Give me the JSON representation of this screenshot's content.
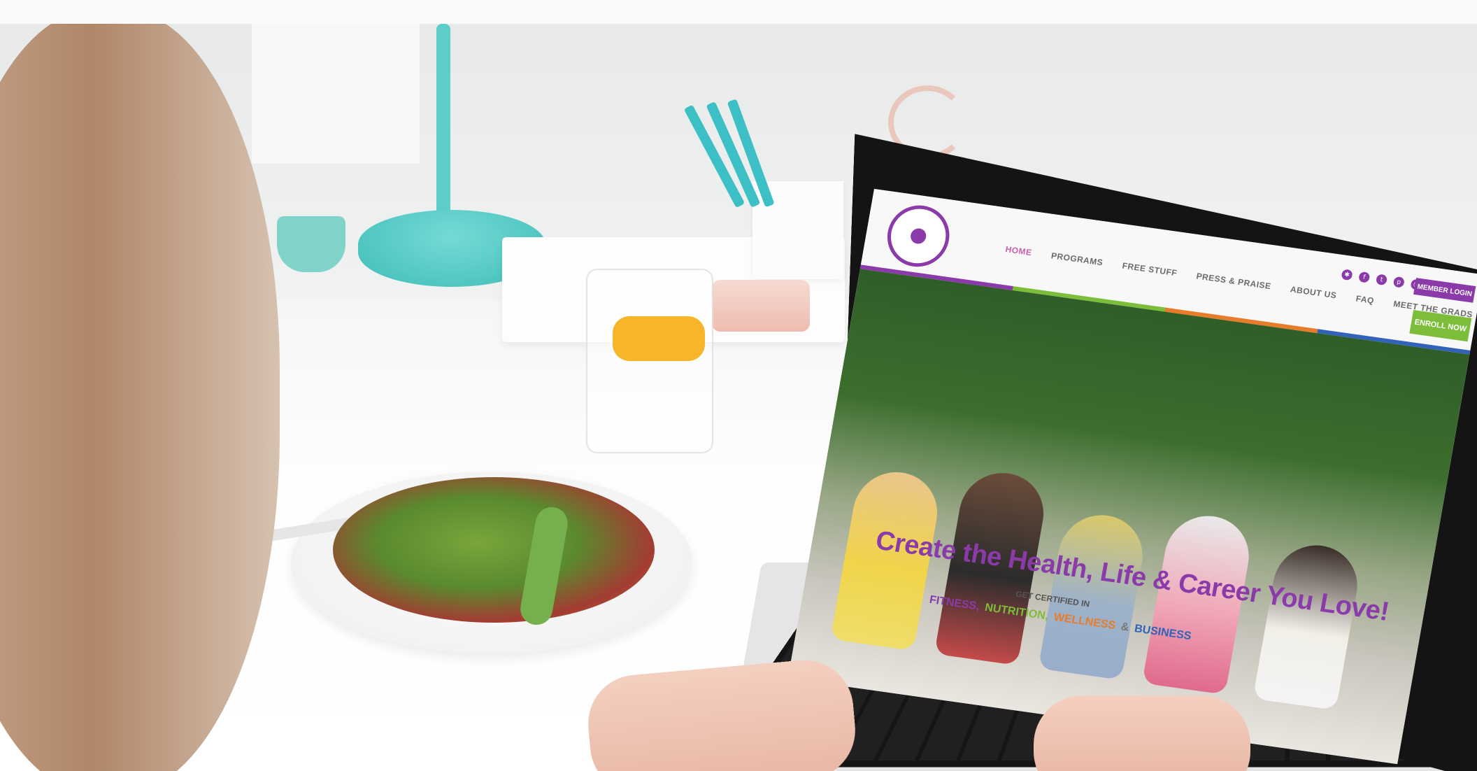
{
  "website": {
    "nav": {
      "items": [
        "HOME",
        "PROGRAMS",
        "FREE STUFF",
        "PRESS & PRAISE",
        "ABOUT US",
        "FAQ",
        "MEET THE GRADS"
      ]
    },
    "member_login": "MEMBER LOGIN",
    "enroll_now": "ENROLL NOW",
    "hero": {
      "title": "Create the Health, Life & Career You Love!",
      "subtitle": "GET CERTIFIED IN",
      "tags": [
        "FITNESS,",
        "NUTRITION,",
        "WELLNESS",
        "&",
        "BUSINESS"
      ]
    },
    "social_icons": [
      "yelp-icon",
      "facebook-icon",
      "twitter-icon",
      "pinterest-icon",
      "instagram-icon"
    ]
  },
  "colors": {
    "purple": "#8a3ba9",
    "green": "#7cbd3a",
    "orange": "#e77c2a",
    "blue": "#3363b8",
    "teal": "#3fbdb7"
  }
}
